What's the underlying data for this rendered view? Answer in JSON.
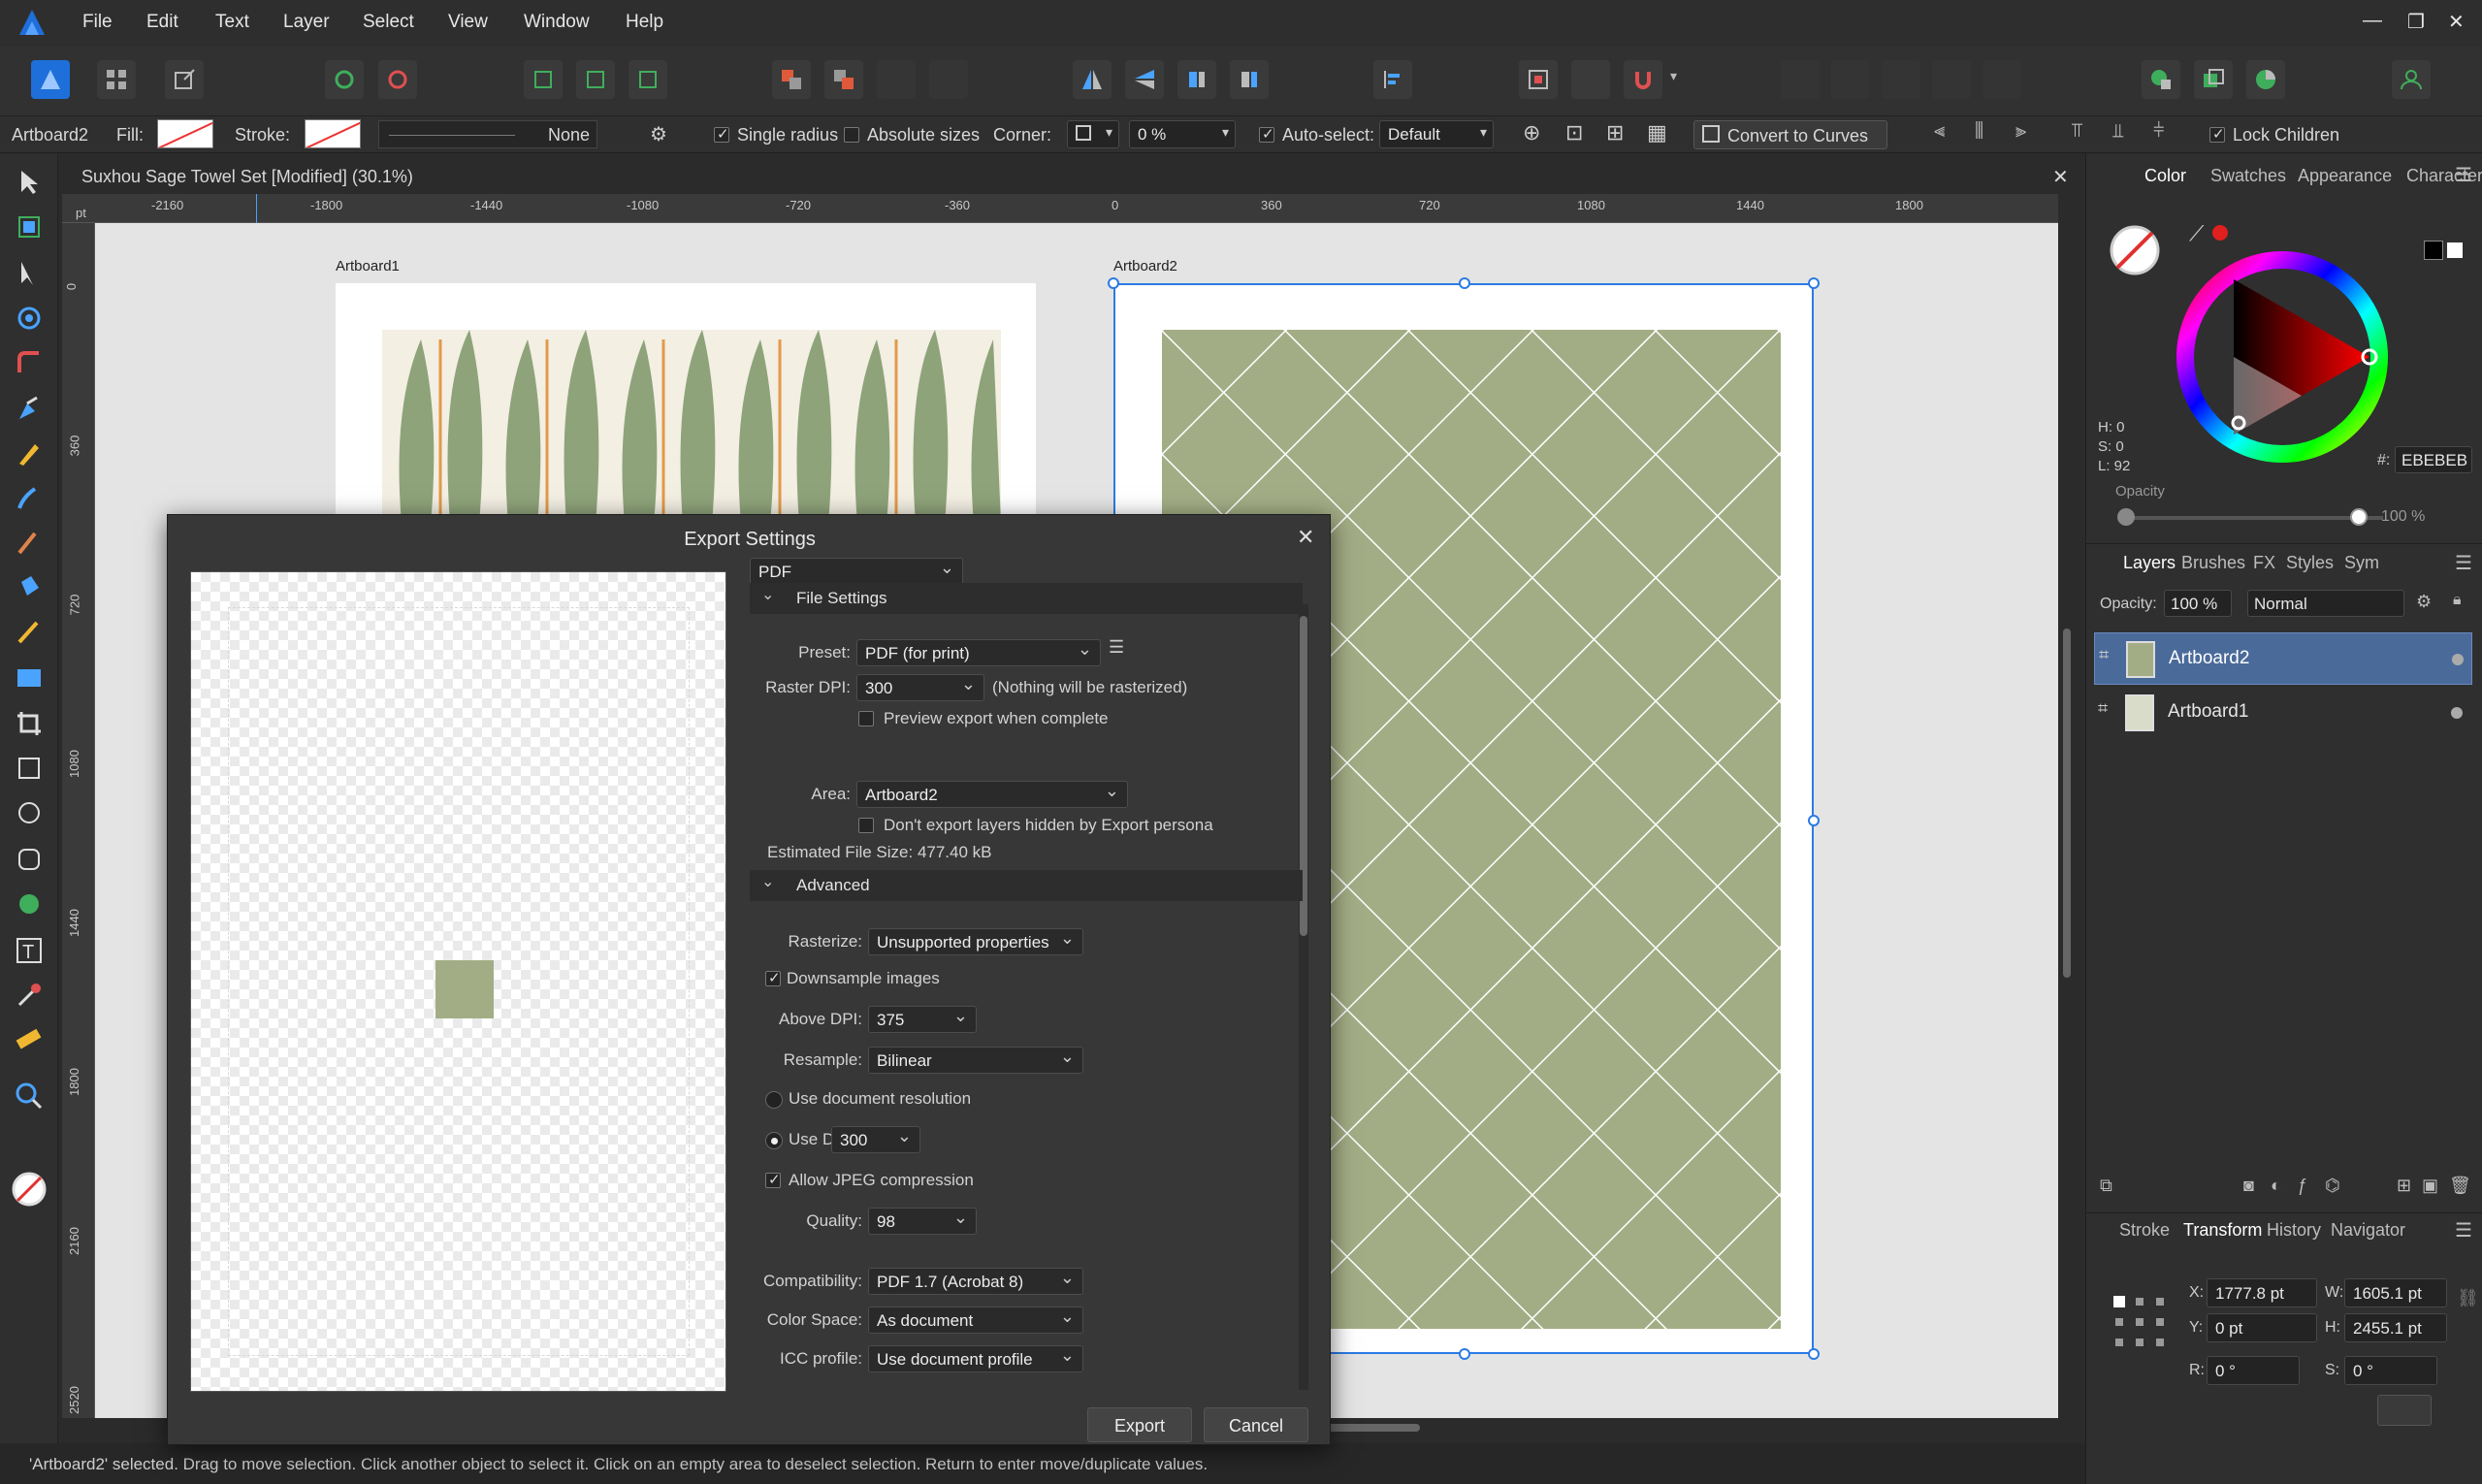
{
  "menu": [
    "File",
    "Edit",
    "Text",
    "Layer",
    "Select",
    "View",
    "Window",
    "Help"
  ],
  "context": {
    "selection_name": "Artboard2",
    "fill_label": "Fill:",
    "stroke_label": "Stroke:",
    "stroke_style": "None",
    "single_radius": "Single radius",
    "absolute_sizes": "Absolute sizes",
    "corner_label": "Corner:",
    "corner_value": "0 %",
    "auto_select": "Auto-select:",
    "auto_select_value": "Default",
    "convert_to_curves": "Convert to Curves",
    "lock_children": "Lock Children"
  },
  "document": {
    "title": "Suxhou Sage Towel Set [Modified] (30.1%)",
    "ruler_unit": "pt",
    "ruler_top": [
      "-2160",
      "-1800",
      "-1440",
      "-1080",
      "-720",
      "-360",
      "0",
      "360",
      "720",
      "1080",
      "1440",
      "1800"
    ],
    "ruler_left": [
      "0",
      "360",
      "720",
      "1080",
      "1440",
      "1800",
      "2160",
      "2520"
    ],
    "artboard1": "Artboard1",
    "artboard2": "Artboard2"
  },
  "status": {
    "text": "'Artboard2' selected. Drag to move selection. Click another object to select it. Click on an empty area to deselect selection. Return to enter move/duplicate values."
  },
  "color_panel": {
    "tabs": [
      "Color",
      "Swatches",
      "Appearance",
      "Character"
    ],
    "h": "H: 0",
    "s": "S: 0",
    "l": "L: 92",
    "hex_label": "#:",
    "hex": "EBEBEB",
    "opacity_label": "Opacity",
    "opacity_value": "100 %"
  },
  "layers_panel": {
    "tabs": [
      "Layers",
      "Brushes",
      "FX",
      "Styles",
      "Sym"
    ],
    "opacity_label": "Opacity:",
    "opacity_value": "100 %",
    "blend_mode": "Normal",
    "layers": [
      {
        "name": "Artboard2"
      },
      {
        "name": "Artboard1"
      }
    ]
  },
  "transform_panel": {
    "tabs": [
      "Stroke",
      "Transform",
      "History",
      "Navigator"
    ],
    "x_label": "X:",
    "x": "1777.8 pt",
    "y_label": "Y:",
    "y": "0 pt",
    "w_label": "W:",
    "w": "1605.1 pt",
    "h_label": "H:",
    "h": "2455.1 pt",
    "r_label": "R:",
    "r": "0 °",
    "s_label": "S:",
    "s": "0 °"
  },
  "dialog": {
    "title": "Export Settings",
    "format": "PDF",
    "file_settings": "File Settings",
    "preset_label": "Preset:",
    "preset": "PDF (for print)",
    "raster_dpi_label": "Raster DPI:",
    "raster_dpi": "300",
    "raster_note": "(Nothing will be rasterized)",
    "preview_export": "Preview export when complete",
    "area_label": "Area:",
    "area": "Artboard2",
    "dont_export_hidden": "Don't export layers hidden by Export persona",
    "estimated_size": "Estimated File Size: 477.40 kB",
    "advanced": "Advanced",
    "rasterize_label": "Rasterize:",
    "rasterize": "Unsupported properties",
    "downsample": "Downsample images",
    "above_dpi_label": "Above DPI:",
    "above_dpi": "375",
    "resample_label": "Resample:",
    "resample": "Bilinear",
    "use_doc_res": "Use document resolution",
    "use_dpi_label": "Use DPI:",
    "use_dpi": "300",
    "allow_jpeg": "Allow JPEG compression",
    "quality_label": "Quality:",
    "quality": "98",
    "compat_label": "Compatibility:",
    "compat": "PDF 1.7 (Acrobat 8)",
    "colorspace_label": "Color Space:",
    "colorspace": "As document",
    "icc_label": "ICC profile:",
    "icc": "Use document profile",
    "export_btn": "Export",
    "cancel_btn": "Cancel"
  },
  "colors": {
    "sage": "#a3ad85",
    "selection_blue": "#2b7be4",
    "layer_highlight": "#4a6a9a"
  }
}
